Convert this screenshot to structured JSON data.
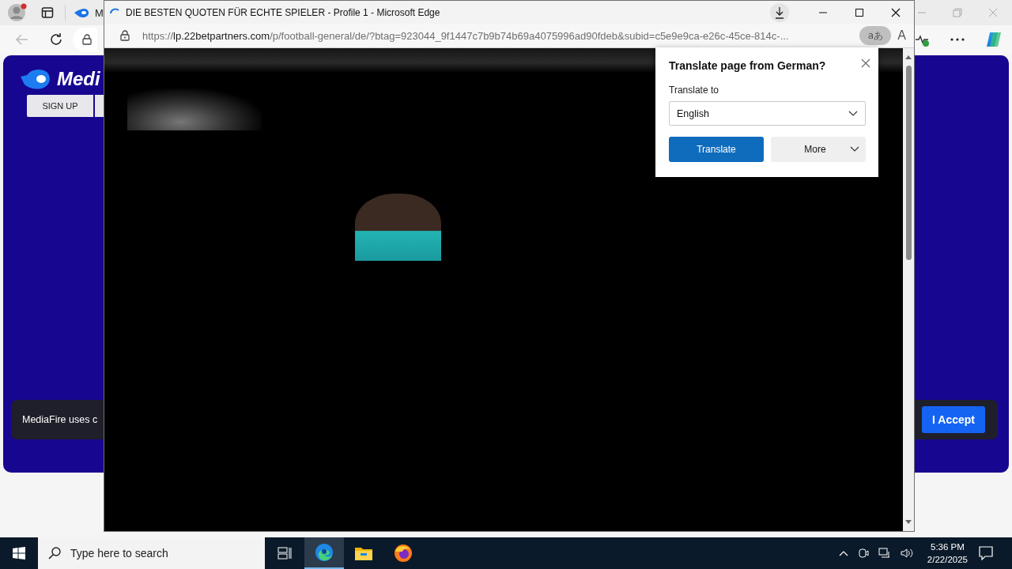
{
  "background_browser": {
    "tab": {
      "label": "M"
    },
    "page": {
      "logo_text": "Medi",
      "signup_button": "SIGN UP",
      "cookie_banner": {
        "text": "MediaFire uses c",
        "accept_button": "I Accept"
      }
    }
  },
  "popup_window": {
    "title": "DIE BESTEN QUOTEN FÜR ECHTE SPIELER - Profile 1 - Microsoft Edge",
    "url": "https://**lp.22betpartners.com**/p/football-general/de/?btag=923044_9f1447c7b9b74b69a4075996ad90fdeb&subid=c5e9e9ca-e26c-45ce-814c-...",
    "translate_button": "aあ",
    "read_aloud_button": "A",
    "translate_flyout": {
      "title": "Translate page from German?",
      "label": "Translate to",
      "language": "English",
      "translate_button": "Translate",
      "more_button": "More"
    }
  },
  "taskbar": {
    "search": {
      "placeholder": "Type here to search"
    },
    "apps": [
      {
        "kind": "edge",
        "selected": true
      },
      {
        "kind": "explorer",
        "selected": false
      },
      {
        "kind": "firefox",
        "selected": false
      }
    ],
    "time": "5:36 PM",
    "date": "2/22/2025"
  }
}
